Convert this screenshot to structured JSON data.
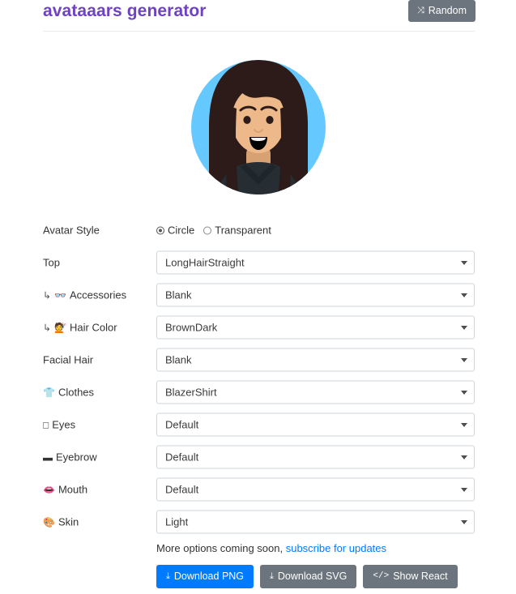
{
  "header": {
    "title": "avataaars generator",
    "random_button": {
      "label": "Random",
      "icon": "shuffle-icon",
      "glyph": "⤨"
    }
  },
  "avatar": {
    "style": "Circle",
    "colors": {
      "circle_background": "#65C9FF",
      "hair": "#2C1B18",
      "skin": "#EDB98A",
      "clothes": "#262E33",
      "collar": "#B7C1DB",
      "eyes": "#2C1B18",
      "mouth": "#000000"
    }
  },
  "form": {
    "rows": [
      {
        "label": "Avatar Style",
        "icon": null,
        "sub": false,
        "control": "radio",
        "options": [
          {
            "label": "Circle",
            "checked": true
          },
          {
            "label": "Transparent",
            "checked": false
          }
        ]
      },
      {
        "label": "Top",
        "icon": null,
        "sub": false,
        "control": "select",
        "value": "LongHairStraight"
      },
      {
        "label": "Accessories",
        "icon": "glasses-icon",
        "glyph": "👓",
        "sub": true,
        "control": "select",
        "value": "Blank"
      },
      {
        "label": "Hair Color",
        "icon": "haircut-icon",
        "glyph": "💇",
        "sub": true,
        "control": "select",
        "value": "BrownDark"
      },
      {
        "label": "Facial Hair",
        "icon": null,
        "sub": false,
        "control": "select",
        "value": "Blank"
      },
      {
        "label": "Clothes",
        "icon": "tshirt-icon",
        "glyph": "👕",
        "sub": false,
        "control": "select",
        "value": "BlazerShirt"
      },
      {
        "label": "Eyes",
        "icon": "eyes-icon",
        "glyph": "□",
        "sub": false,
        "control": "select",
        "value": "Default"
      },
      {
        "label": "Eyebrow",
        "icon": "eyebrow-icon",
        "glyph": "▬",
        "sub": false,
        "control": "select",
        "value": "Default"
      },
      {
        "label": "Mouth",
        "icon": "mouth-icon",
        "glyph": "👄",
        "sub": false,
        "control": "select",
        "value": "Default"
      },
      {
        "label": "Skin",
        "icon": "palette-icon",
        "glyph": "🎨",
        "sub": false,
        "control": "select",
        "value": "Light"
      }
    ],
    "sub_arrow": "↳"
  },
  "footer": {
    "note_text": "More options coming soon,",
    "link_text": "subscribe for updates",
    "buttons": [
      {
        "label": "Download PNG",
        "icon": "download-icon",
        "glyph": "⤓",
        "variant": "primary"
      },
      {
        "label": "Download SVG",
        "icon": "download-icon",
        "glyph": "⤓",
        "variant": "secondary"
      },
      {
        "label": "Show React",
        "icon": "code-icon",
        "glyph": "</>",
        "variant": "secondary"
      }
    ]
  },
  "colors": {
    "brand_purple": "#6f42c1",
    "link_blue": "#007bff",
    "secondary_gray": "#6c757d"
  }
}
